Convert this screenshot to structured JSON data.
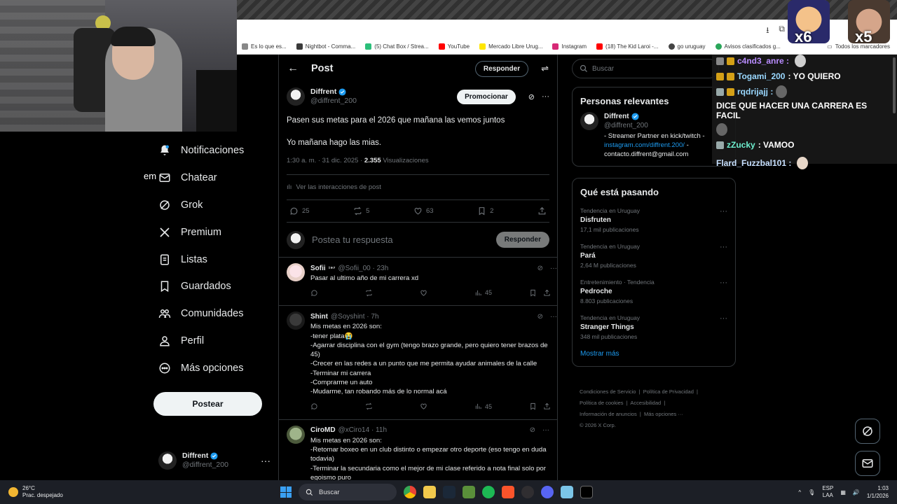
{
  "browser": {
    "bookmarks": [
      {
        "label": "Es lo que es...",
        "color": "#888888"
      },
      {
        "label": "Nightbot - Comma...",
        "color": "#3a3a3a"
      },
      {
        "label": "(5) Chat Box / Strea...",
        "color": "#2bbf7a"
      },
      {
        "label": "YouTube",
        "color": "#ff0000"
      },
      {
        "label": "Mercado Libre Urug...",
        "color": "#ffe600"
      },
      {
        "label": "Instagram",
        "color": "#d62976"
      },
      {
        "label": "(18) The Kid Laroi -...",
        "color": "#ff0000"
      },
      {
        "label": "go uruguay",
        "color": "#444444"
      },
      {
        "label": "Avisos clasificados g...",
        "color": "#2aa65a"
      }
    ],
    "bookmarks_right": "Todos los marcadores"
  },
  "nav": {
    "em_label": "em",
    "items": [
      {
        "label": "Notificaciones",
        "icon": "bell-icon"
      },
      {
        "label": "Chatear",
        "icon": "mail-icon"
      },
      {
        "label": "Grok",
        "icon": "grok-icon"
      },
      {
        "label": "Premium",
        "icon": "x-logo-icon"
      },
      {
        "label": "Listas",
        "icon": "list-icon"
      },
      {
        "label": "Guardados",
        "icon": "bookmark-icon"
      },
      {
        "label": "Comunidades",
        "icon": "communities-icon"
      },
      {
        "label": "Perfil",
        "icon": "user-icon"
      },
      {
        "label": "Más opciones",
        "icon": "more-circle-icon"
      }
    ],
    "post_button": "Postear",
    "account": {
      "display_name": "Diffrent",
      "handle": "@diffrent_200"
    }
  },
  "post": {
    "header_title": "Post",
    "header_reply": "Responder",
    "author": {
      "display_name": "Diffrent",
      "handle": "@diffrent_200"
    },
    "promote": "Promocionar",
    "text": [
      "Pasen sus metas para el 2026 que mañana las vemos juntos",
      "Yo mañana hago las mias."
    ],
    "meta_time": "1:30 a. m. · 31 dic. 2025 · ",
    "views_count": "2.355",
    "views_label": " Visualizaciones",
    "interactions": "Ver las interacciones de post",
    "stats": {
      "replies": "25",
      "reposts": "5",
      "likes": "63",
      "bookmarks": "2"
    },
    "composer_placeholder": "Postea tu respuesta",
    "composer_button": "Responder"
  },
  "replies": [
    {
      "name": "Sofii",
      "sup": "¹⁹⁷",
      "handle": "@Sofii_00 · 23h",
      "text": "Pasar al ultimo año de mi carrera xd",
      "views": "45"
    },
    {
      "name": "Shint",
      "sup": "",
      "handle": "@Soyshint · 7h",
      "text": "Mis metas en 2026 son:\n-tener plata😭\n-Agarrar disciplina con el gym (tengo brazo grande, pero quiero tener brazos de 45)\n-Crecer en las redes a un punto que me permita ayudar animales de la calle\n-Terminar mi carrera\n-Comprarme un auto\n-Mudarme, tan robando más de lo normal acá",
      "views": "45"
    },
    {
      "name": "CiroMD",
      "sup": "",
      "handle": "@xCiro14 · 11h",
      "text": "Mis metas en 2026 son:\n-Retomar boxeo en un club distinto o empezar otro deporte (eso tengo en duda todavia)\n-Terminar la secundaria como el mejor de mi clase referido a nota final solo por egoismo puro",
      "views": ""
    }
  ],
  "sidebar": {
    "search_placeholder": "Buscar",
    "relevant_title": "Personas relevantes",
    "relevant": {
      "display_name": "Diffrent",
      "handle": "@diffrent_200",
      "bio_1": "- Streamer Partner en kick/twitch -",
      "bio_link": "instagram.com/diffrent.200/",
      "bio_dash": " -",
      "bio_2": "contacto.diffrent@gmail.com"
    },
    "trends_title": "Qué está pasando",
    "trends": [
      {
        "category": "Tendencia en Uruguay",
        "name": "Disfruten",
        "count": "17,1 mil publicaciones"
      },
      {
        "category": "Tendencia en Uruguay",
        "name": "Pará",
        "count": "2,64 M publicaciones"
      },
      {
        "category": "Entretenimiento · Tendencia",
        "name": "Pedroche",
        "count": "8.803 publicaciones"
      },
      {
        "category": "Tendencia en Uruguay",
        "name": "Stranger Things",
        "count": "348 mil publicaciones"
      }
    ],
    "show_more": "Mostrar más",
    "footer": [
      "Condiciones de Servicio",
      "Política de Privacidad",
      "Política de cookies",
      "Accesibilidad",
      "Información de anuncios",
      "Más opciones ···",
      "© 2026 X Corp."
    ]
  },
  "chat": {
    "messages": [
      {
        "user": "c4nd3_anre :",
        "text": "",
        "color": "#b98cff"
      },
      {
        "user": "Togami_200",
        "text": ": YO QUIERO",
        "color": "#9ad8ff"
      },
      {
        "user": "rqdrijajj :",
        "text": "DICE QUE HACER UNA CARRERA ES FACIL",
        "color": "#9ad8ff"
      },
      {
        "user": "zZucky",
        "text": ": VAMOO",
        "color": "#6ff0d0"
      },
      {
        "user": "Flard_Fuzzbal101 :",
        "text": "",
        "color": "#c7e0ff"
      }
    ],
    "emote_x1": "x6",
    "emote_x2": "x5"
  },
  "taskbar": {
    "temp": "26°C",
    "weather": "Prac. despejado",
    "search": "Buscar",
    "lang_1": "ESP",
    "lang_2": "LAA",
    "time": "1:03",
    "date": "1/1/2026"
  }
}
